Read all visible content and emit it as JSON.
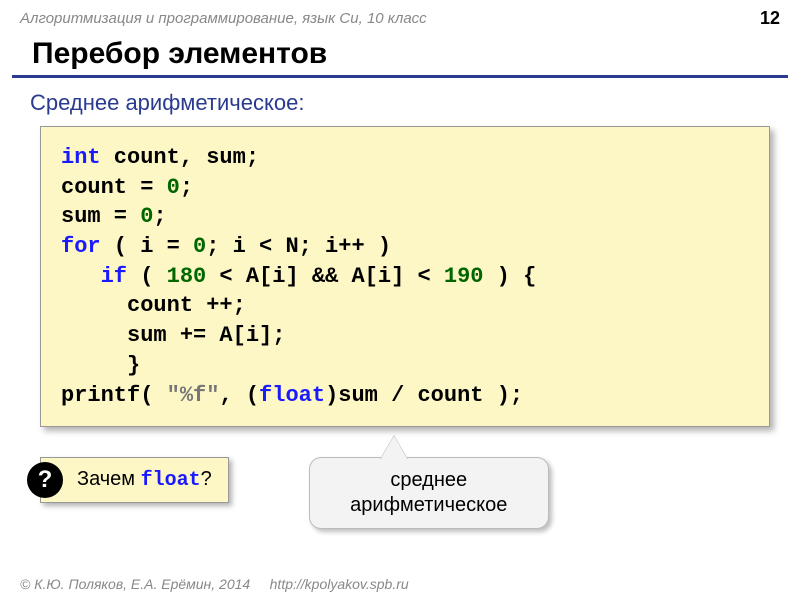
{
  "header": {
    "course": "Алгоритмизация и программирование, язык Си, 10 класс",
    "page": "12"
  },
  "title": "Перебор элементов",
  "subtitle": "Среднее арифметическое:",
  "code": {
    "l1_kw": "int",
    "l1_rest": " count, sum;",
    "l2_a": "count = ",
    "l2_num": "0",
    "l2_b": ";",
    "l3_a": "sum = ",
    "l3_num": "0",
    "l3_b": ";",
    "l4_kw": "for",
    "l4_a": " ( i = ",
    "l4_num": "0",
    "l4_b": "; i < N; i++ ) ",
    "l5_pad": "   ",
    "l5_kw": "if",
    "l5_a": " ( ",
    "l5_num1": "180",
    "l5_b": " < A[i] && A[i] < ",
    "l5_num2": "190",
    "l5_c": " ) {",
    "l6": "     count ++;",
    "l7": "     sum += A[i];",
    "l8": "     }",
    "l9_a": "printf( ",
    "l9_str": "\"%f\"",
    "l9_b": ", (",
    "l9_kw": "float",
    "l9_c": ")sum / count );"
  },
  "question": {
    "mark": "?",
    "text_a": " Зачем ",
    "text_code": "float",
    "text_b": "?"
  },
  "callout": {
    "line1": "среднее",
    "line2": "арифметическое"
  },
  "footer": {
    "copyright": "© К.Ю. Поляков, Е.А. Ерёмин, 2014",
    "url": "http://kpolyakov.spb.ru"
  }
}
